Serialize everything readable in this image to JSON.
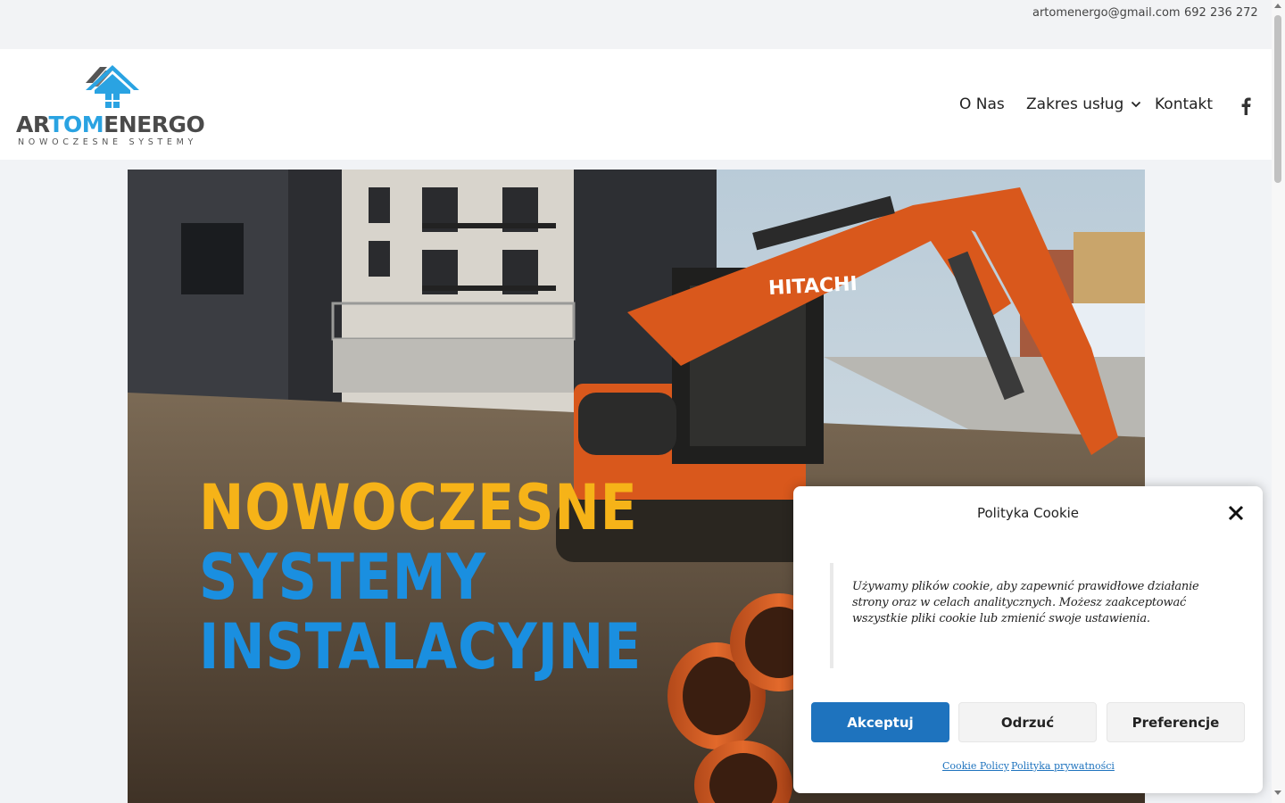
{
  "topbar": {
    "email": "artomenergo@gmail.com",
    "phone": "692 236 272"
  },
  "logo": {
    "part1": "AR",
    "part2": "TOM",
    "part3": "ENERGO",
    "subtitle": "NOWOCZESNE SYSTEMY"
  },
  "nav": {
    "items": [
      {
        "label": "O Nas"
      },
      {
        "label": "Zakres usług",
        "has_dropdown": true
      },
      {
        "label": "Kontakt"
      }
    ],
    "social_icon": "facebook-icon"
  },
  "hero": {
    "line1": "NOWOCZESNE",
    "line2": "SYSTEMY",
    "line3": "INSTALACYJNE",
    "excavator_brand": "HITACHI"
  },
  "cookie": {
    "title": "Polityka Cookie",
    "text": "Używamy plików cookie, aby zapewnić prawidłowe działanie strony oraz w celach analitycznych. Możesz zaakceptować wszystkie pliki cookie lub zmienić swoje ustawienia.",
    "accept": "Akceptuj",
    "reject": "Odrzuć",
    "preferences": "Preferencje",
    "link_cookie_policy": "Cookie Policy",
    "link_privacy": "Polityka prywatności"
  },
  "colors": {
    "accent_blue": "#1e73be",
    "hero_yellow": "#f6b318",
    "hero_blue": "#1a8fe0",
    "excavator_orange": "#d9581c"
  }
}
